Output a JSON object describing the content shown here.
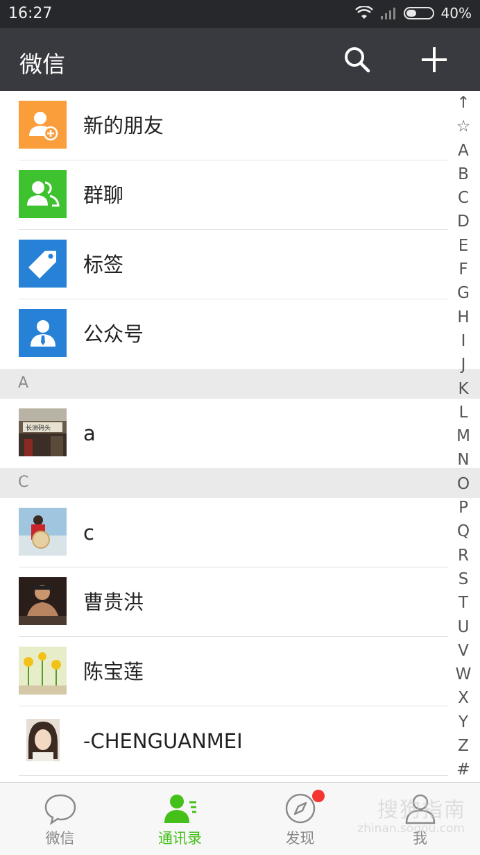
{
  "status_bar": {
    "time": "16:27",
    "battery": "40%",
    "battery_level": 0.4
  },
  "header": {
    "title": "微信"
  },
  "features": [
    {
      "label": "新的朋友",
      "icon": "add-friend-icon",
      "color": "#fa9d3b"
    },
    {
      "label": "群聊",
      "icon": "group-chat-icon",
      "color": "#3fc22f"
    },
    {
      "label": "标签",
      "icon": "tag-icon",
      "color": "#2782d7"
    },
    {
      "label": "公众号",
      "icon": "official-account-icon",
      "color": "#2782d7"
    }
  ],
  "sections": [
    {
      "letter": "A",
      "contacts": [
        {
          "name": "a"
        }
      ]
    },
    {
      "letter": "C",
      "contacts": [
        {
          "name": "c"
        },
        {
          "name": "曹贵洪"
        },
        {
          "name": "陈宝莲"
        },
        {
          "name": "-CHENGUANMEI"
        }
      ]
    }
  ],
  "index": [
    "↑",
    "☆",
    "A",
    "B",
    "C",
    "D",
    "E",
    "F",
    "G",
    "H",
    "I",
    "J",
    "K",
    "L",
    "M",
    "N",
    "O",
    "P",
    "Q",
    "R",
    "S",
    "T",
    "U",
    "V",
    "W",
    "X",
    "Y",
    "Z",
    "#"
  ],
  "tabs": [
    {
      "label": "微信",
      "icon": "chat-bubble-icon",
      "active": false
    },
    {
      "label": "通讯录",
      "icon": "contacts-icon",
      "active": true
    },
    {
      "label": "发现",
      "icon": "compass-icon",
      "active": false
    },
    {
      "label": "我",
      "icon": "profile-icon",
      "active": false
    }
  ],
  "watermark": {
    "text": "搜狗指南",
    "sub": "zhinan.sogou.com"
  },
  "colors": {
    "accent": "#45c01a",
    "header": "#393a3f",
    "badge": "#f43530"
  }
}
